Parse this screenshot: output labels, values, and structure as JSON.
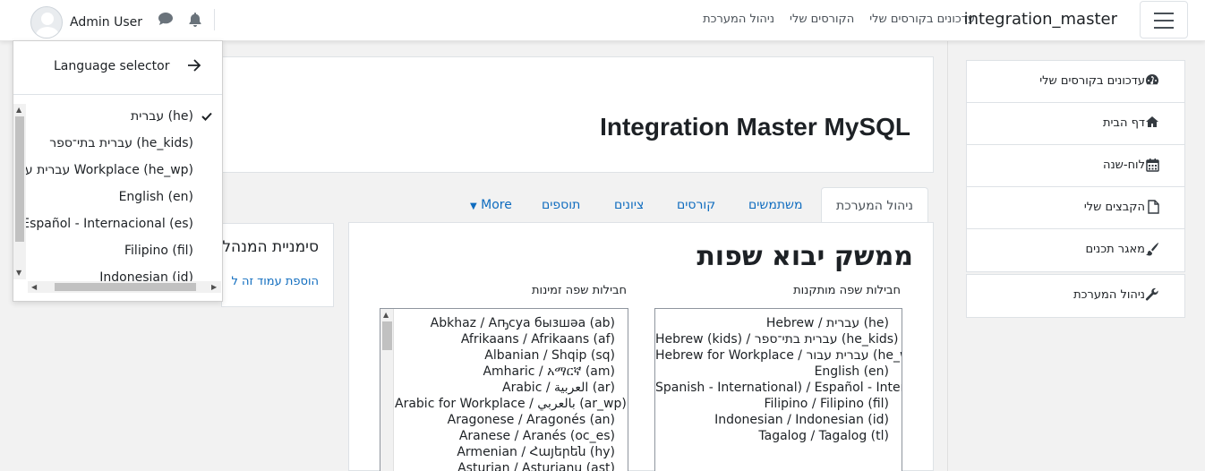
{
  "navbar": {
    "brand": "integration_master",
    "links": [
      "עדכונים בקורסים שלי",
      "הקורסים שלי",
      "ניהול המערכת"
    ],
    "user_name": "Admin User"
  },
  "language_menu": {
    "title": "Language selector",
    "items": [
      "עברית (he)",
      "עברית בתי־ספר (he_kids)",
      "עברית עבור Workplace (he_wp)",
      "English (en)",
      "Español - Internacional (es)",
      "Filipino (fil)",
      "Indonesian (id)"
    ],
    "selected": "עברית (he)"
  },
  "drawer": {
    "items": [
      {
        "label": "עדכונים בקורסים שלי",
        "icon": "dashboard-icon"
      },
      {
        "label": "דף הבית",
        "icon": "home-icon"
      },
      {
        "label": "לוח-שנה",
        "icon": "calendar-icon"
      },
      {
        "label": "הקבצים שלי",
        "icon": "file-icon"
      },
      {
        "label": "מאגר תכנים",
        "icon": "paint-brush-icon"
      }
    ],
    "admin_item": {
      "label": "ניהול המערכת",
      "icon": "wrench-icon"
    }
  },
  "header": {
    "title": "Integration Master MySQL"
  },
  "tabs": [
    {
      "label": "ניהול המערכת",
      "active": true
    },
    {
      "label": "משתמשים"
    },
    {
      "label": "קורסים"
    },
    {
      "label": "ציונים"
    },
    {
      "label": "תוספים"
    },
    {
      "label": "More"
    }
  ],
  "main": {
    "heading": "ממשק יבוא שפות",
    "installed_label": "חבילות שפה מותקנות",
    "available_label": "חבילות שפה זמינות",
    "installed_packs": [
      "Hebrew / עברית (he)",
      "Hebrew (kids) / עברית בתי־ספר (he_kids)",
      "Hebrew for Workplace / עברית עבור (he_wp)",
      "English (en)",
      "Spanish - International) / Español - Internacional (es)",
      "Filipino / Filipino (fil)",
      "Indonesian / Indonesian (id)",
      "Tagalog / Tagalog (tl)"
    ],
    "available_packs": [
      "Abkhaz / Аҧсуа бызшәа (ab)",
      "Afrikaans / Afrikaans (af)",
      "Albanian / Shqip (sq)",
      "Amharic / አማርኛ (am)",
      "Arabic / العربية (ar)",
      "Arabic for Workplace / بالعربي (ar_wp)",
      "Aragonese / Aragonés (an)",
      "Aranese / Aranés (oc_es)",
      "Armenian / Հայերեն (hy)",
      "Asturian / Asturianu (ast)"
    ]
  },
  "left_block": {
    "title": "סימניית המנהל",
    "link": "הוספת עמוד זה ל"
  }
}
